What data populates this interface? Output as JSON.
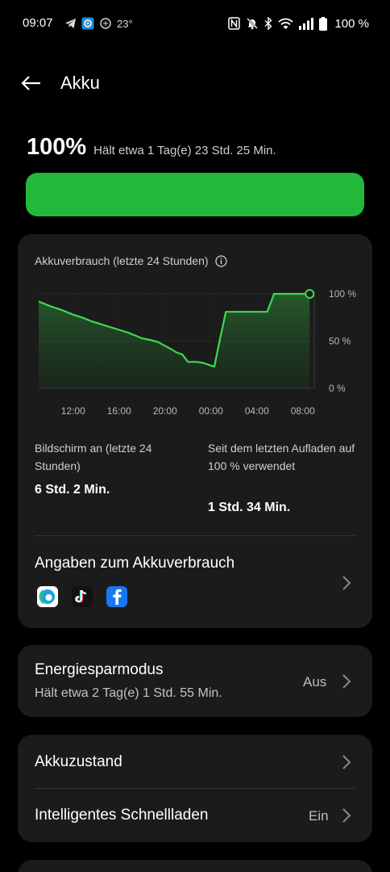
{
  "status_bar": {
    "time": "09:07",
    "temperature": "23°",
    "battery": "100 %",
    "left_icons": [
      "telegram-icon",
      "app-notification-icon",
      "weather-icon"
    ],
    "right_icons": [
      "nfc-icon",
      "mute-icon",
      "bluetooth-icon",
      "wifi-icon",
      "signal-icon",
      "battery-icon"
    ]
  },
  "header": {
    "title": "Akku",
    "back_icon": "back-arrow-icon"
  },
  "battery": {
    "percent": "100%",
    "remaining": "Hält etwa 1 Tag(e) 23 Std. 25 Min.",
    "level": 1.0,
    "color": "#22b83a"
  },
  "usage_card": {
    "chart_title": "Akkuverbrauch (letzte 24 Stunden)",
    "screen_on_label": "Bildschirm an (letzte 24 Stunden)",
    "screen_on_value": "6 Std. 2 Min.",
    "since_charge_label": "Seit dem letzten Aufladen auf 100 % verwendet",
    "since_charge_value": "1 Std. 34 Min.",
    "details_title": "Angaben zum Akkuverbrauch",
    "apps": [
      "edge-icon",
      "tiktok-icon",
      "facebook-icon"
    ]
  },
  "chart_data": {
    "type": "area",
    "title": "Akkuverbrauch (letzte 24 Stunden)",
    "x_ticks": [
      "12:00",
      "16:00",
      "20:00",
      "00:00",
      "04:00",
      "08:00"
    ],
    "y_ticks": [
      "100 %",
      "50 %",
      "0 %"
    ],
    "ylim": [
      0,
      100
    ],
    "xlim_hours": [
      9,
      33
    ],
    "grid": true,
    "line_color": "#3ed94f",
    "x_hours": [
      9.0,
      10.0,
      11.0,
      12.0,
      12.8,
      13.6,
      14.4,
      15.2,
      16.0,
      16.8,
      17.4,
      18.0,
      18.8,
      19.4,
      20.0,
      20.6,
      21.0,
      21.5,
      22.0,
      22.7,
      23.3,
      23.8,
      24.3,
      24.8,
      25.3,
      26.0,
      27.0,
      28.0,
      28.6,
      28.9,
      29.5,
      30.5,
      31.5,
      32.6
    ],
    "values": [
      92,
      87,
      83,
      78,
      75,
      71,
      68,
      65,
      62,
      59,
      56,
      53,
      51,
      49,
      45,
      41,
      38,
      36,
      28,
      28,
      27,
      25,
      23,
      53,
      81,
      81,
      81,
      81,
      81,
      81,
      100,
      100,
      100,
      100
    ]
  },
  "energy_saver": {
    "title": "Energiesparmodus",
    "subtitle": "Hält etwa 2 Tag(e) 1 Std. 55 Min.",
    "value": "Aus"
  },
  "health": {
    "battery_health": "Akkuzustand",
    "smart_charging": "Intelligentes Schnellladen",
    "smart_charging_value": "Ein"
  }
}
